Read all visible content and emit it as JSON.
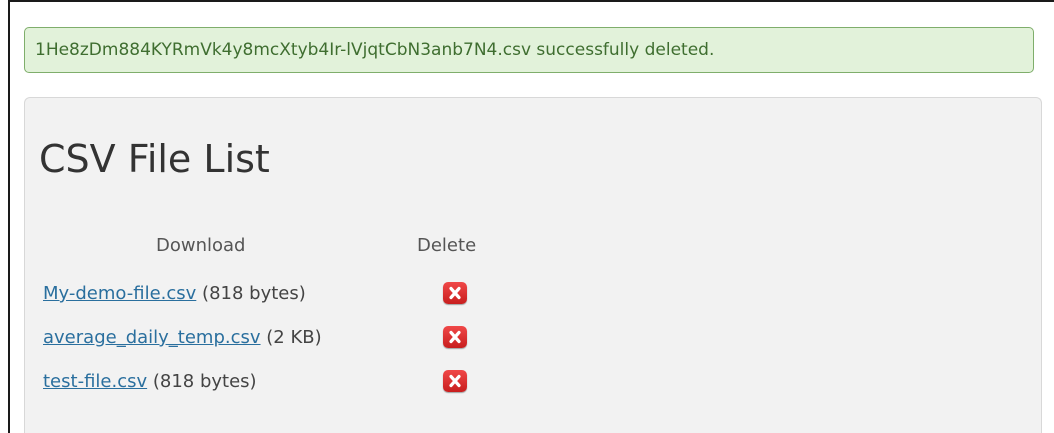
{
  "alert": {
    "message": "1He8zDm884KYRmVk4y8mcXtyb4Ir-lVjqtCbN3anb7N4.csv successfully deleted.",
    "color": "#3f6e30"
  },
  "panel": {
    "title": "CSV File List",
    "headers": {
      "download": "Download",
      "delete": "Delete"
    },
    "files": [
      {
        "name": "My-demo-file.csv",
        "size": "(818 bytes)",
        "delete_icon": "delete-x-icon"
      },
      {
        "name": "average_daily_temp.csv",
        "size": "(2 KB)",
        "delete_icon": "delete-x-icon"
      },
      {
        "name": "test-file.csv",
        "size": "(818 bytes)",
        "delete_icon": "delete-x-icon"
      }
    ]
  },
  "colors": {
    "link": "#2a6f9e",
    "alert_bg": "#e2f2da",
    "delete_button": "#d92b2b"
  }
}
